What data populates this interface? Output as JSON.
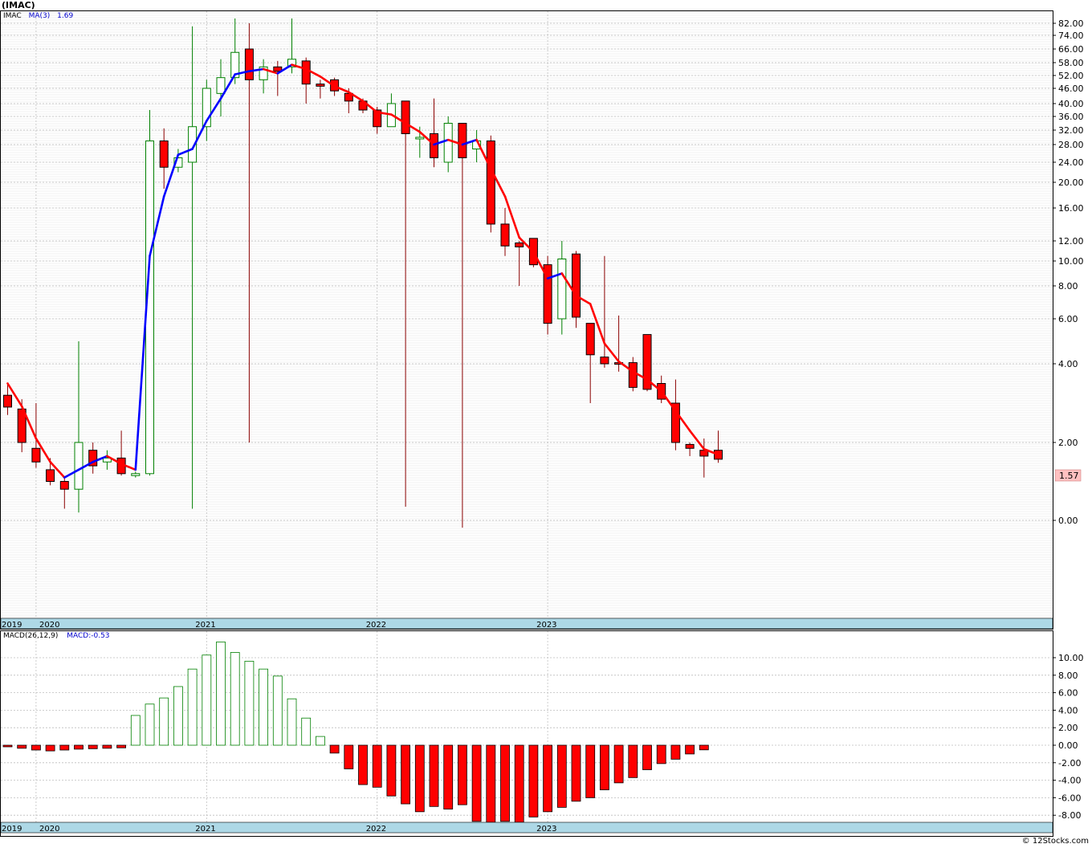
{
  "title": "(IMAC)",
  "footer": "© 12Stocks.com",
  "legend_price": {
    "symbol": "IMAC",
    "ma_label": "MA(3)",
    "ma_value": "1.69"
  },
  "legend_macd": {
    "label": "MACD(26,12,9)",
    "value_label": "MACD:-0.53"
  },
  "last_price_label": "1.57",
  "colors": {
    "up": "#008000",
    "down": "#ff0000",
    "ma_up": "#0000ff",
    "ma_down": "#ff0000",
    "band": "#add8e6",
    "grid": "#c8c8c8"
  },
  "chart_data": [
    {
      "type": "candlestick",
      "scale": "custom-log",
      "y_ticks": [
        "82.00",
        "74.00",
        "66.00",
        "58.00",
        "52.00",
        "46.00",
        "40.00",
        "36.00",
        "32.00",
        "28.00",
        "24.00",
        "20.00",
        "16.00",
        "12.00",
        "10.00",
        "8.00",
        "6.00",
        "4.00",
        "2.00",
        "0.00"
      ],
      "x_labels": [
        "2019",
        "2020",
        "2021",
        "2022",
        "2023"
      ],
      "series": [
        {
          "date": "2019-11",
          "open": 3.2,
          "high": 3.5,
          "low": 2.7,
          "close": 2.9
        },
        {
          "date": "2019-12",
          "open": 2.85,
          "high": 3.1,
          "low": 1.75,
          "close": 2.0
        },
        {
          "date": "2020-01",
          "open": 1.85,
          "high": 3.0,
          "low": 1.35,
          "close": 1.5
        },
        {
          "date": "2020-02",
          "open": 1.3,
          "high": 1.6,
          "low": 0.9,
          "close": 1.0
        },
        {
          "date": "2020-03",
          "open": 1.0,
          "high": 1.1,
          "low": 0.3,
          "close": 0.8
        },
        {
          "date": "2020-04",
          "open": 0.8,
          "high": 5.0,
          "low": 0.2,
          "close": 2.0
        },
        {
          "date": "2020-05",
          "open": 1.8,
          "high": 2.0,
          "low": 1.2,
          "close": 1.4
        },
        {
          "date": "2020-06",
          "open": 1.5,
          "high": 1.8,
          "low": 1.3,
          "close": 1.6
        },
        {
          "date": "2020-07",
          "open": 1.6,
          "high": 2.3,
          "low": 1.15,
          "close": 1.2
        },
        {
          "date": "2020-08",
          "open": 1.15,
          "high": 1.25,
          "low": 1.1,
          "close": 1.2
        },
        {
          "date": "2020-09",
          "open": 1.2,
          "high": 38.0,
          "low": 1.15,
          "close": 29.0
        },
        {
          "date": "2020-10",
          "open": 29.0,
          "high": 32.5,
          "low": 19.0,
          "close": 23.0
        },
        {
          "date": "2020-11",
          "open": 23.0,
          "high": 27.0,
          "low": 22.0,
          "close": 25.0
        },
        {
          "date": "2020-12",
          "open": 24.0,
          "high": 80.0,
          "low": 0.3,
          "close": 33.0
        },
        {
          "date": "2021-01",
          "open": 33.0,
          "high": 50.0,
          "low": 29.0,
          "close": 46.0
        },
        {
          "date": "2021-02",
          "open": 44.0,
          "high": 60.0,
          "low": 36.0,
          "close": 51.0
        },
        {
          "date": "2021-03",
          "open": 51.0,
          "high": 86.0,
          "low": 48.0,
          "close": 64.0
        },
        {
          "date": "2021-04",
          "open": 66.0,
          "high": 82.0,
          "low": 2.0,
          "close": 50.0
        },
        {
          "date": "2021-05",
          "open": 50.0,
          "high": 60.0,
          "low": 44.0,
          "close": 56.0
        },
        {
          "date": "2021-06",
          "open": 56.0,
          "high": 59.0,
          "low": 43.0,
          "close": 54.0
        },
        {
          "date": "2021-07",
          "open": 56.0,
          "high": 86.0,
          "low": 53.0,
          "close": 60.0
        },
        {
          "date": "2021-08",
          "open": 59.0,
          "high": 61.0,
          "low": 40.0,
          "close": 48.0
        },
        {
          "date": "2021-09",
          "open": 48.0,
          "high": 50.0,
          "low": 42.0,
          "close": 47.0
        },
        {
          "date": "2021-10",
          "open": 50.0,
          "high": 51.0,
          "low": 43.0,
          "close": 45.0
        },
        {
          "date": "2021-11",
          "open": 44.0,
          "high": 46.0,
          "low": 37.0,
          "close": 41.0
        },
        {
          "date": "2021-12",
          "open": 41.0,
          "high": 42.0,
          "low": 37.0,
          "close": 38.0
        },
        {
          "date": "2022-01",
          "open": 38.0,
          "high": 39.0,
          "low": 31.0,
          "close": 33.0
        },
        {
          "date": "2022-02",
          "open": 33.0,
          "high": 44.0,
          "low": 33.0,
          "close": 40.0
        },
        {
          "date": "2022-03",
          "open": 41.0,
          "high": 41.0,
          "low": 0.35,
          "close": 31.0
        },
        {
          "date": "2022-04",
          "open": 30.0,
          "high": 33.0,
          "low": 25.0,
          "close": 30.0
        },
        {
          "date": "2022-05",
          "open": 31.0,
          "high": 42.0,
          "low": 23.0,
          "close": 25.0
        },
        {
          "date": "2022-06",
          "open": 24.0,
          "high": 36.0,
          "low": 22.0,
          "close": 34.0
        },
        {
          "date": "2022-07",
          "open": 34.0,
          "high": 34.0,
          "low": -0.15,
          "close": 25.0
        },
        {
          "date": "2022-08",
          "open": 27.0,
          "high": 32.0,
          "low": 24.0,
          "close": 29.0
        },
        {
          "date": "2022-09",
          "open": 29.0,
          "high": 30.5,
          "low": 13.0,
          "close": 14.0
        },
        {
          "date": "2022-10",
          "open": 14.0,
          "high": 16.0,
          "low": 10.5,
          "close": 11.5
        },
        {
          "date": "2022-11",
          "open": 11.8,
          "high": 12.0,
          "low": 8.0,
          "close": 11.4
        },
        {
          "date": "2022-12",
          "open": 12.3,
          "high": 12.3,
          "low": 9.5,
          "close": 9.7
        },
        {
          "date": "2023-01",
          "open": 9.7,
          "high": 10.5,
          "low": 5.3,
          "close": 5.8
        },
        {
          "date": "2023-02",
          "open": 6.0,
          "high": 12.0,
          "low": 5.3,
          "close": 10.2
        },
        {
          "date": "2023-03",
          "open": 10.7,
          "high": 11.0,
          "low": 5.6,
          "close": 6.1
        },
        {
          "date": "2023-04",
          "open": 5.8,
          "high": 5.8,
          "low": 3.0,
          "close": 4.4
        },
        {
          "date": "2023-05",
          "open": 4.3,
          "high": 10.5,
          "low": 3.9,
          "close": 4.0
        },
        {
          "date": "2023-06",
          "open": 4.05,
          "high": 6.2,
          "low": 3.8,
          "close": 4.0
        },
        {
          "date": "2023-07",
          "open": 4.05,
          "high": 4.3,
          "low": 3.3,
          "close": 3.4
        },
        {
          "date": "2023-08",
          "open": 5.3,
          "high": 5.3,
          "low": 3.3,
          "close": 3.35
        },
        {
          "date": "2023-09",
          "open": 3.5,
          "high": 3.7,
          "low": 3.0,
          "close": 3.1
        },
        {
          "date": "2023-10",
          "open": 3.0,
          "high": 3.6,
          "low": 1.8,
          "close": 2.0
        },
        {
          "date": "2023-11",
          "open": 1.95,
          "high": 2.0,
          "low": 1.65,
          "close": 1.85
        },
        {
          "date": "2023-12",
          "open": 1.8,
          "high": 2.1,
          "low": 1.1,
          "close": 1.65
        },
        {
          "date": "2024-01",
          "open": 1.8,
          "high": 2.3,
          "low": 1.48,
          "close": 1.57
        }
      ],
      "ma3": [
        3.5,
        2.92,
        2.1,
        1.5,
        1.1,
        1.3,
        1.5,
        1.65,
        1.45,
        1.3,
        10.5,
        17.8,
        25.7,
        27.0,
        34.7,
        42.0,
        52.5,
        54.0,
        55.0,
        53.0,
        57.0,
        55.0,
        51.5,
        47.0,
        44.5,
        41.0,
        37.3,
        36.6,
        34.0,
        31.5,
        28.0,
        29.3,
        28.0,
        29.3,
        22.7,
        17.8,
        12.4,
        10.9,
        8.6,
        9.0,
        7.4,
        6.9,
        4.9,
        4.1,
        3.8,
        3.6,
        3.3,
        2.8,
        2.3,
        1.83,
        1.69
      ]
    },
    {
      "type": "bar",
      "name": "MACD(26,12,9)",
      "y_ticks": [
        "10.00",
        "8.00",
        "6.00",
        "4.00",
        "2.00",
        "0.00",
        "-2.00",
        "-4.00",
        "-6.00",
        "-8.00"
      ],
      "x_labels": [
        "2019",
        "2020",
        "2021",
        "2022",
        "2023"
      ],
      "values": [
        -0.15,
        -0.35,
        -0.55,
        -0.65,
        -0.55,
        -0.45,
        -0.4,
        -0.35,
        -0.3,
        3.4,
        4.7,
        5.4,
        6.7,
        8.7,
        10.3,
        11.8,
        10.6,
        9.6,
        8.7,
        7.9,
        5.3,
        3.1,
        1.0,
        -0.9,
        -2.7,
        -4.5,
        -4.8,
        -5.8,
        -6.7,
        -7.6,
        -7.0,
        -7.3,
        -6.8,
        -8.7,
        -8.8,
        -8.7,
        -8.8,
        -8.2,
        -7.6,
        -7.1,
        -6.4,
        -6.0,
        -5.1,
        -4.3,
        -3.7,
        -2.8,
        -2.1,
        -1.6,
        -1.0,
        -0.53
      ]
    }
  ]
}
